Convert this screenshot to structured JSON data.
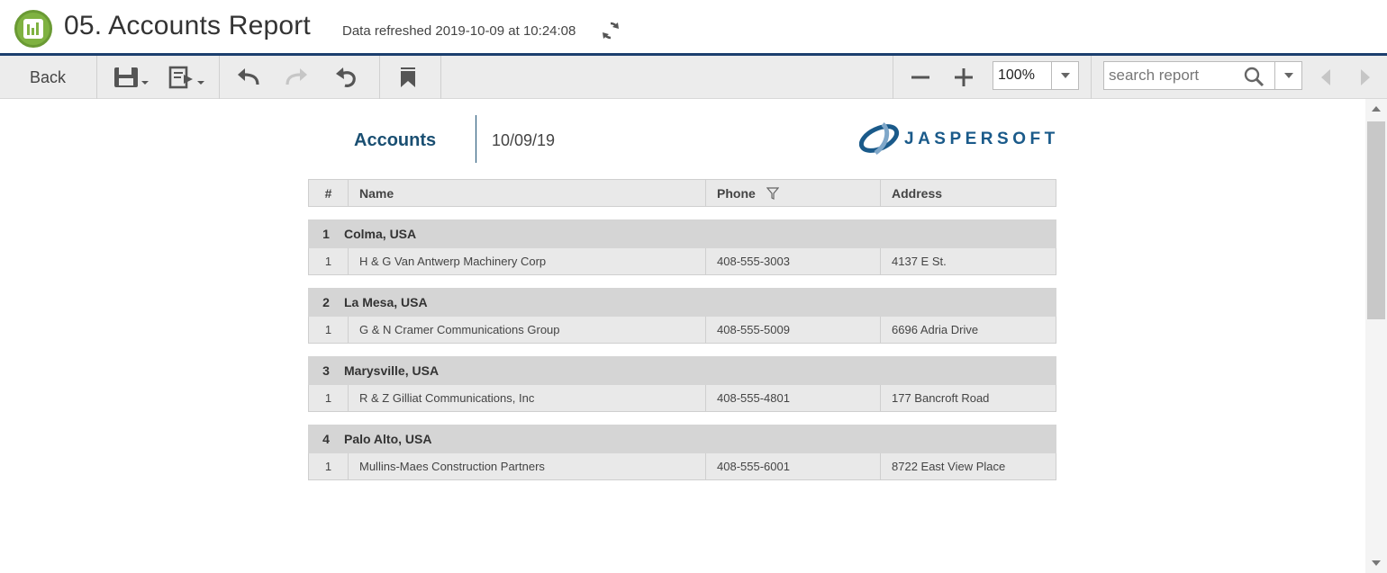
{
  "header": {
    "title": "05. Accounts Report",
    "refresh_text": "Data refreshed 2019-10-09 at 10:24:08"
  },
  "toolbar": {
    "back_label": "Back",
    "zoom_value": "100%",
    "search_placeholder": "search report"
  },
  "report": {
    "title": "Accounts",
    "date": "10/09/19",
    "logo_text": "JASPERSOFT",
    "columns": [
      "#",
      "Name",
      "Phone",
      "Address"
    ],
    "groups": [
      {
        "num": "1",
        "label": "Colma, USA",
        "rows": [
          {
            "num": "1",
            "name": "H & G Van Antwerp Machinery Corp",
            "phone": "408-555-3003",
            "address": "4137 E St."
          }
        ]
      },
      {
        "num": "2",
        "label": "La Mesa, USA",
        "rows": [
          {
            "num": "1",
            "name": "G & N Cramer Communications Group",
            "phone": "408-555-5009",
            "address": "6696 Adria Drive"
          }
        ]
      },
      {
        "num": "3",
        "label": "Marysville, USA",
        "rows": [
          {
            "num": "1",
            "name": "R & Z Gilliat Communications, Inc",
            "phone": "408-555-4801",
            "address": "177 Bancroft Road"
          }
        ]
      },
      {
        "num": "4",
        "label": "Palo Alto, USA",
        "rows": [
          {
            "num": "1",
            "name": "Mullins-Maes Construction Partners",
            "phone": "408-555-6001",
            "address": "8722 East View Place"
          }
        ]
      }
    ]
  },
  "colors": {
    "accent": "#1c3f6e",
    "title_blue": "#1a4f72",
    "icon_green": "#7fb241"
  }
}
